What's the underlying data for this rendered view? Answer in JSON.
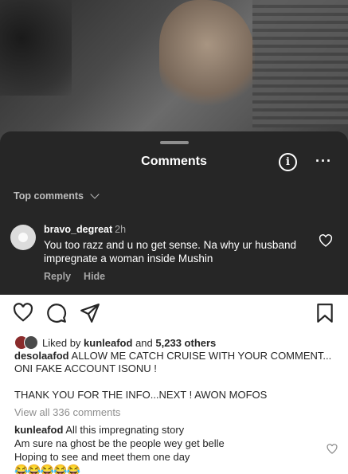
{
  "sheet": {
    "title": "Comments",
    "sort_label": "Top comments",
    "comment": {
      "username": "bravo_degreat",
      "time": "2h",
      "text": "You too razz and u no get sense.  Na why ur husband impregnate a woman inside Mushin",
      "reply_label": "Reply",
      "hide_label": "Hide"
    }
  },
  "post": {
    "liked_prefix": "Liked by",
    "liked_user": "kunleafod",
    "liked_and": "and",
    "liked_others": "5,233 others",
    "caption_user": "desolaafod",
    "caption_line1": "ALLOW ME CATCH CRUISE WITH YOUR COMMENT...",
    "caption_line2": "ONI FAKE ACCOUNT ISONU !",
    "caption_line3": "THANK YOU FOR THE INFO...NEXT ! AWON MOFOS",
    "view_all": "View all 336 comments",
    "comment_user": "kunleafod",
    "comment_line1": "All this impregnating story",
    "comment_line2": "Am sure na ghost be the people wey get belle",
    "comment_line3": "Hoping to see and meet them one day",
    "comment_emojis": "😂😂😂😂😂"
  },
  "icons": [
    "info-icon",
    "more-icon",
    "chevron-down-icon",
    "heart-icon",
    "comment-icon",
    "share-icon",
    "bookmark-icon"
  ],
  "colors": {
    "sheet_bg": "#262626",
    "text_dark": "#262626",
    "muted": "#8e8e8e"
  }
}
